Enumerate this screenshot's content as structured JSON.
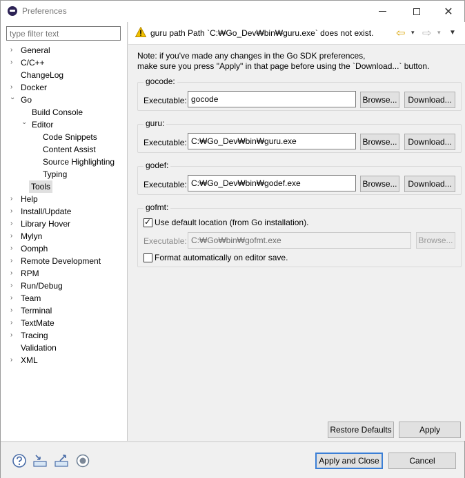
{
  "window": {
    "title": "Preferences"
  },
  "filter": {
    "placeholder": "type filter text"
  },
  "tree": {
    "items": [
      {
        "label": "General",
        "arrow": "›"
      },
      {
        "label": "C/C++",
        "arrow": "›"
      },
      {
        "label": "ChangeLog",
        "arrow": ""
      },
      {
        "label": "Docker",
        "arrow": "›"
      },
      {
        "label": "Go",
        "arrow": "⌄"
      },
      {
        "label": "Build Console",
        "arrow": ""
      },
      {
        "label": "Editor",
        "arrow": "⌄"
      },
      {
        "label": "Code Snippets",
        "arrow": ""
      },
      {
        "label": "Content Assist",
        "arrow": ""
      },
      {
        "label": "Source Highlighting",
        "arrow": ""
      },
      {
        "label": "Typing",
        "arrow": ""
      },
      {
        "label": "Tools",
        "arrow": ""
      },
      {
        "label": "Help",
        "arrow": "›"
      },
      {
        "label": "Install/Update",
        "arrow": "›"
      },
      {
        "label": "Library Hover",
        "arrow": "›"
      },
      {
        "label": "Mylyn",
        "arrow": "›"
      },
      {
        "label": "Oomph",
        "arrow": "›"
      },
      {
        "label": "Remote Development",
        "arrow": "›"
      },
      {
        "label": "RPM",
        "arrow": "›"
      },
      {
        "label": "Run/Debug",
        "arrow": "›"
      },
      {
        "label": "Team",
        "arrow": "›"
      },
      {
        "label": "Terminal",
        "arrow": "›"
      },
      {
        "label": "TextMate",
        "arrow": "›"
      },
      {
        "label": "Tracing",
        "arrow": "›"
      },
      {
        "label": "Validation",
        "arrow": ""
      },
      {
        "label": "XML",
        "arrow": "›"
      }
    ]
  },
  "message": {
    "text": "guru path Path `C:₩Go_Dev₩bin₩guru.exe` does not exist."
  },
  "nav": {
    "back": "⇦",
    "forward": "⇨",
    "dropdown": "▾",
    "menu": "▼"
  },
  "note": {
    "line1": "Note: if you've made any changes in the Go SDK preferences,",
    "line2": "make sure you press \"Apply\" in that page before using the `Download...` button."
  },
  "gocode": {
    "title": "gocode:",
    "label": "Executable:",
    "value": "gocode",
    "browse": "Browse...",
    "download": "Download..."
  },
  "guru": {
    "title": "guru:",
    "label": "Executable:",
    "value": "C:₩Go_Dev₩bin₩guru.exe",
    "browse": "Browse...",
    "download": "Download..."
  },
  "godef": {
    "title": "godef:",
    "label": "Executable:",
    "value": "C:₩Go_Dev₩bin₩godef.exe",
    "browse": "Browse...",
    "download": "Download..."
  },
  "gofmt": {
    "title": "gofmt:",
    "use_default": "Use default location (from Go installation).",
    "use_default_checked": true,
    "label": "Executable:",
    "value": "C:₩Go₩bin₩gofmt.exe",
    "browse": "Browse...",
    "format_auto": "Format automatically on editor save.",
    "format_auto_checked": false
  },
  "buttons": {
    "restore_defaults": "Restore Defaults",
    "apply": "Apply",
    "apply_and_close": "Apply and Close",
    "cancel": "Cancel"
  },
  "colors": {
    "warning": "#f2c200",
    "default_button_border": "#3b7fd6"
  }
}
